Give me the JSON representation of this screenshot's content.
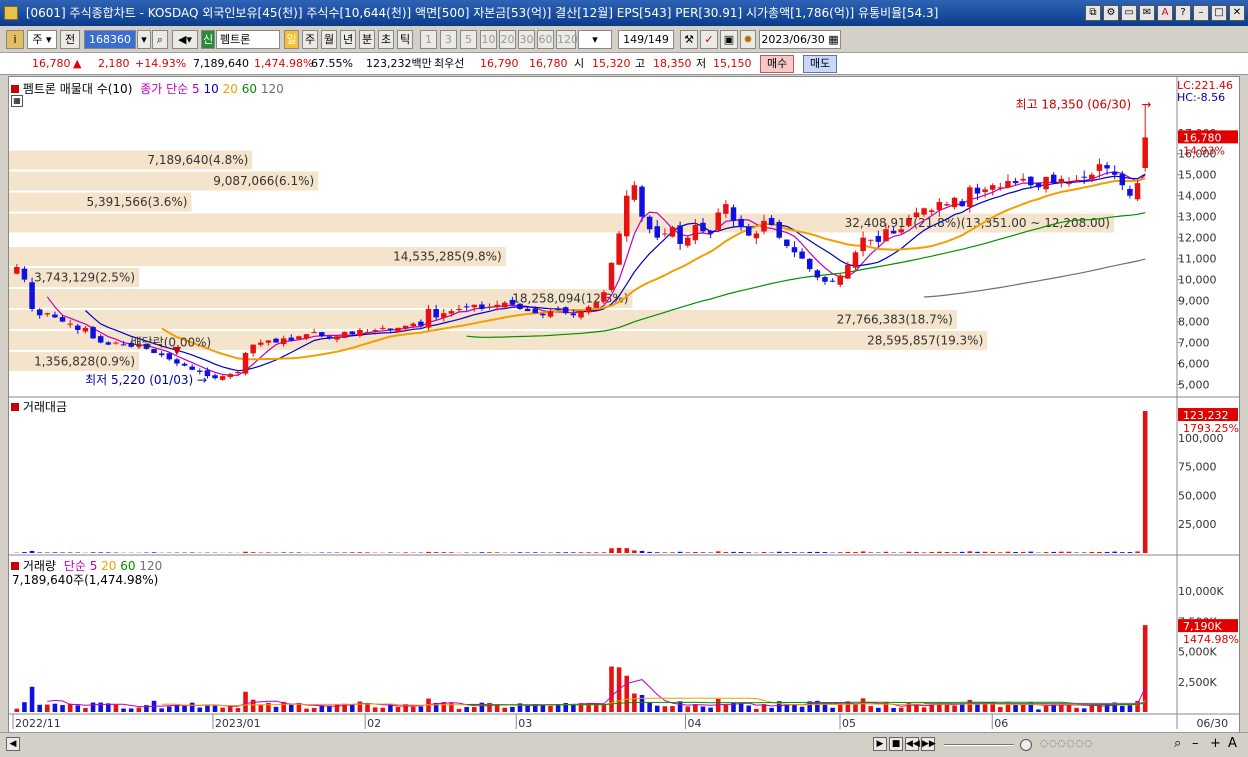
{
  "window": {
    "title": "[0601] 주식종합차트 - KOSDAQ 외국인보유[45(천)] 주식수[10,644(천)] 액면[500] 자본금[53(억)] 결산[12월] EPS[543] PER[30.91] 시가총액[1,786(억)] 유통비율[54.3]",
    "controls": [
      "⧉",
      "⚙",
      "▭",
      "✉",
      "A",
      "?",
      "–",
      "□",
      "✕"
    ]
  },
  "toolbar": {
    "kind_label": "주",
    "all_label": "전",
    "code_value": "168360",
    "stock_name": "펨트론",
    "new_badge": "신",
    "periods": [
      "일",
      "주",
      "월",
      "년",
      "분",
      "초",
      "틱"
    ],
    "active_period": "일",
    "intervals": [
      "1",
      "3",
      "5",
      "10",
      "20",
      "30",
      "60",
      "120"
    ],
    "count_label": "149",
    "count_total": "/149",
    "date_value": "2023/06/30"
  },
  "price": {
    "current": "16,780",
    "change": "2,180",
    "change_pct": "+14.93%",
    "volume": "7,189,640",
    "volume_pct": "1,474.98%",
    "turnover": "67.55%",
    "amount": "123,232백만",
    "best_ask_label": "최우선",
    "best_ask": "16,790",
    "best_bid": "16,780",
    "open_label": "시",
    "open": "15,320",
    "high_label": "고",
    "high": "18,350",
    "low_label": "저",
    "low": "15,150",
    "buy_label": "매수",
    "sell_label": "매도"
  },
  "panels": {
    "main_title": "펨트론 매물대 수(10)",
    "ma_label": "종가 단순",
    "ma_periods": [
      "5",
      "10",
      "20",
      "60",
      "120"
    ],
    "volume_amount_title": "거래대금",
    "volume_title": "거래량",
    "volume_ma_label": "단순",
    "volume_ma_periods": [
      "5",
      "20",
      "60",
      "120"
    ],
    "volume_summary": "7,189,640주(1,474.98%)",
    "lc_label": "LC:221.46",
    "hc_label": "HC:-8.56"
  },
  "colors": {
    "up": "#e81010",
    "down": "#1010e0",
    "ma5": "#c000c0",
    "ma10": "#0000c0",
    "ma20": "#f0a000",
    "ma60": "#009000",
    "ma120": "#707070",
    "profile": "#f5e4cc"
  },
  "chart_data": [
    {
      "type": "candlestick",
      "title": "펨트론 일봉",
      "x_ticks": [
        "2022/11",
        "2023/01",
        "02",
        "03",
        "04",
        "05",
        "06",
        "06/30"
      ],
      "y_ticks": [
        5000,
        6000,
        7000,
        8000,
        9000,
        10000,
        11000,
        12000,
        13000,
        14000,
        15000,
        16000,
        17000
      ],
      "ylim": [
        4500,
        18800
      ],
      "closes": [
        10600,
        10000,
        8600,
        8300,
        8400,
        8200,
        8000,
        7900,
        7600,
        7700,
        7200,
        7000,
        6900,
        7000,
        6900,
        6800,
        6900,
        6700,
        6500,
        6400,
        6200,
        6000,
        5900,
        5700,
        5600,
        5400,
        5300,
        5400,
        5500,
        5600,
        6500,
        6900,
        7000,
        7100,
        7000,
        7200,
        7100,
        7300,
        7400,
        7500,
        7300,
        7200,
        7300,
        7500,
        7400,
        7600,
        7500,
        7600,
        7700,
        7600,
        7700,
        7800,
        7900,
        7800,
        8600,
        8200,
        8400,
        8500,
        8600,
        8700,
        8800,
        8600,
        8700,
        8800,
        8900,
        8800,
        8600,
        8500,
        8400,
        8300,
        8500,
        8600,
        8400,
        8300,
        8500,
        8700,
        8900,
        9400,
        10800,
        12200,
        14000,
        14500,
        13000,
        12400,
        12000,
        12200,
        12500,
        11700,
        12000,
        12600,
        12300,
        12200,
        13200,
        13600,
        12800,
        12500,
        12100,
        12200,
        12800,
        12600,
        12000,
        11600,
        11300,
        11000,
        10500,
        10100,
        9900,
        9900,
        10200,
        10700,
        11300,
        12000,
        11900,
        11800,
        12400,
        12200,
        12400,
        12900,
        13200,
        13400,
        13300,
        13700,
        13600,
        13900,
        13500,
        14400,
        14100,
        14300,
        14500,
        14400,
        14700,
        14600,
        14800,
        14500,
        14400,
        14900,
        14600,
        14800,
        14600,
        14700,
        14900,
        15000,
        15500,
        15300,
        15000,
        14500,
        14000,
        14600,
        16780
      ],
      "volume_ma_windows": [
        5,
        10,
        20,
        60,
        120
      ],
      "annotations": [
        {
          "text": "최고 18,350 (06/30)",
          "kind": "high"
        },
        {
          "text": "최저 5,220 (01/03)",
          "kind": "low"
        },
        {
          "text": "배당락(0.00%)",
          "kind": "event"
        }
      ],
      "last_price_label": "16,780",
      "last_pct_label": "14.93%",
      "volume_profile": [
        {
          "label": "1,356,828(0.9%)",
          "price_low": 5600,
          "price_high": 6600,
          "pct": 0.9
        },
        {
          "label": "28,595,857(19.3%)",
          "price_low": 6600,
          "price_high": 7600,
          "pct": 19.3
        },
        {
          "label": "27,766,383(18.7%)",
          "price_low": 7600,
          "price_high": 8600,
          "pct": 18.7
        },
        {
          "label": "18,258,094(12.3%)",
          "price_low": 8600,
          "price_high": 9600,
          "pct": 12.3
        },
        {
          "label": "3,743,129(2.5%)",
          "price_low": 9600,
          "price_high": 10600,
          "pct": 2.5
        },
        {
          "label": "14,535,285(9.8%)",
          "price_low": 10600,
          "price_high": 11600,
          "pct": 9.8
        },
        {
          "label": "32,408,917(21.8%)(13,351.00 ~ 12,208.00)",
          "price_low": 12200,
          "price_high": 13200,
          "pct": 21.8
        },
        {
          "label": "5,391,566(3.6%)",
          "price_low": 13200,
          "price_high": 14200,
          "pct": 3.6
        },
        {
          "label": "9,087,066(6.1%)",
          "price_low": 14200,
          "price_high": 15200,
          "pct": 6.1
        },
        {
          "label": "7,189,640(4.8%)",
          "price_low": 15200,
          "price_high": 16200,
          "pct": 4.8
        }
      ]
    },
    {
      "type": "bar",
      "title": "거래대금",
      "y_ticks": [
        25000,
        50000,
        75000,
        100000
      ],
      "ylim": [
        0,
        125000
      ],
      "last_label": "123,232",
      "last_pct": "1793.25%"
    },
    {
      "type": "bar",
      "title": "거래량",
      "y_ticks": [
        "2,500K",
        "5,000K",
        "7,500K",
        "10,000K"
      ],
      "ylim": [
        0,
        12000000
      ],
      "last_label": "7,190K",
      "last_pct": "1474.98%"
    }
  ],
  "scrollbar": {
    "buttons": [
      "▶",
      "■",
      "◀◀",
      "◀",
      "▶▶"
    ],
    "zoom_out": "–",
    "zoom_in": "+",
    "font_label": "A"
  }
}
